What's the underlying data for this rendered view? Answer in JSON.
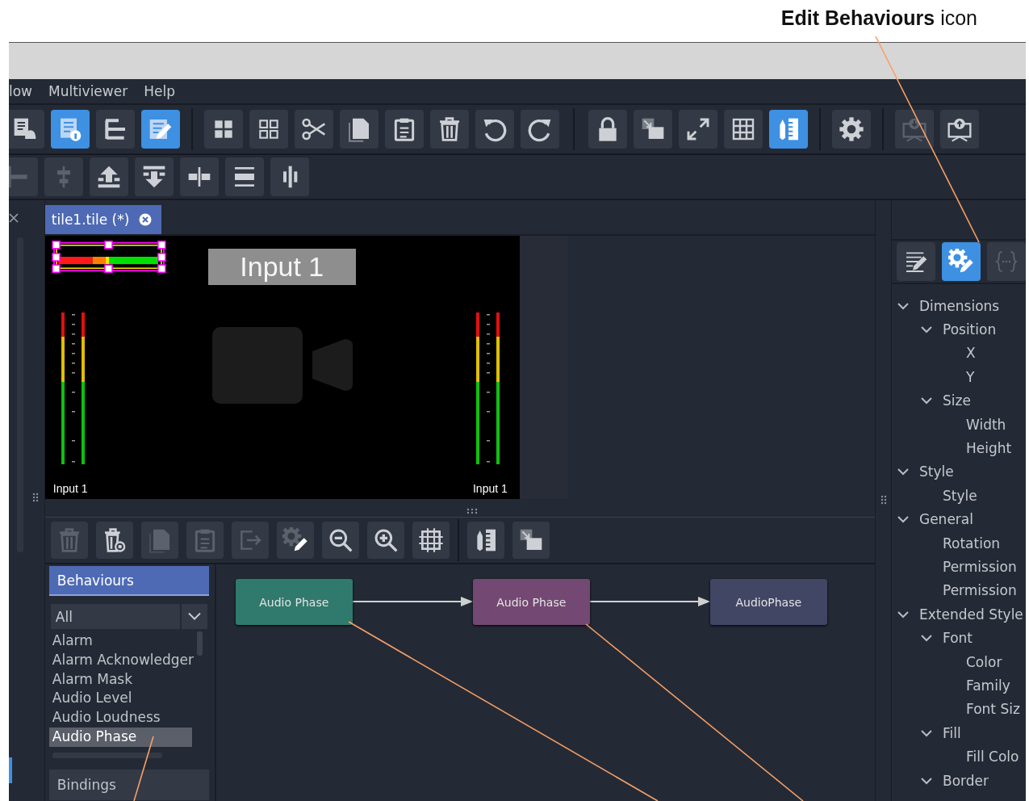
{
  "annotation": {
    "label": "**Edit Behaviours** icon"
  },
  "menu": [
    {
      "label": "low"
    },
    {
      "label": "Multiviewer"
    },
    {
      "label": "Help"
    }
  ],
  "toolbar": {
    "groups": [
      {
        "buttons": [
          {
            "kind": "alarm_doc",
            "selected": false,
            "disabled": false
          },
          {
            "kind": "doc_info",
            "selected": true,
            "disabled": false
          },
          {
            "kind": "hierarchy",
            "selected": false,
            "disabled": false
          },
          {
            "kind": "edit_doc",
            "selected": true,
            "disabled": false
          }
        ]
      },
      {
        "buttons": [
          {
            "kind": "grid_solid",
            "selected": false,
            "disabled": false
          },
          {
            "kind": "grid_outline",
            "selected": false,
            "disabled": false
          },
          {
            "kind": "scissors",
            "selected": false,
            "disabled": false
          },
          {
            "kind": "copy",
            "selected": false,
            "disabled": false
          },
          {
            "kind": "clipboard",
            "selected": false,
            "disabled": false
          },
          {
            "kind": "trash",
            "selected": false,
            "disabled": false
          },
          {
            "kind": "undo",
            "selected": false,
            "disabled": false
          },
          {
            "kind": "redo",
            "selected": false,
            "disabled": false
          }
        ]
      },
      {
        "buttons": [
          {
            "kind": "lock",
            "selected": false,
            "disabled": false
          },
          {
            "kind": "send_back",
            "selected": false,
            "disabled": false
          },
          {
            "kind": "expand",
            "selected": false,
            "disabled": false
          },
          {
            "kind": "table",
            "selected": false,
            "disabled": false
          },
          {
            "kind": "ruler_pencil",
            "selected": true,
            "disabled": false
          }
        ]
      },
      {
        "buttons": [
          {
            "kind": "gear",
            "selected": false,
            "disabled": false
          }
        ]
      },
      {
        "buttons": [
          {
            "kind": "monitor_down",
            "selected": false,
            "disabled": true
          },
          {
            "kind": "monitor_up",
            "selected": false,
            "disabled": false
          }
        ]
      }
    ]
  },
  "align_toolbar": {
    "buttons": [
      {
        "kind": "align_left",
        "selected": false,
        "disabled": true
      },
      {
        "kind": "align_center",
        "selected": false,
        "disabled": true
      },
      {
        "kind": "move_top",
        "selected": false,
        "disabled": false
      },
      {
        "kind": "move_bottom",
        "selected": false,
        "disabled": false
      },
      {
        "kind": "distribute_h",
        "selected": false,
        "disabled": false
      },
      {
        "kind": "distribute_v",
        "selected": false,
        "disabled": false
      },
      {
        "kind": "center_v",
        "selected": false,
        "disabled": false
      }
    ]
  },
  "editor_tab": {
    "label": "tile1.tile (*)",
    "selected": true
  },
  "canvas": {
    "title_label": "Input 1",
    "meter_labels": [
      "Input 1",
      "Input 1"
    ]
  },
  "graph_toolbar": {
    "groups": [
      {
        "buttons": [
          {
            "kind": "trash",
            "selected": false,
            "disabled": true
          },
          {
            "kind": "trash_clear",
            "selected": false,
            "disabled": false
          },
          {
            "kind": "copy",
            "selected": false,
            "disabled": true
          },
          {
            "kind": "clipboard",
            "selected": false,
            "disabled": true
          },
          {
            "kind": "export",
            "selected": false,
            "disabled": true
          },
          {
            "kind": "gear_edit",
            "selected": false,
            "disabled": true
          },
          {
            "kind": "zoom_out",
            "selected": false,
            "disabled": false
          },
          {
            "kind": "zoom_in",
            "selected": false,
            "disabled": false
          },
          {
            "kind": "fit_grid",
            "selected": false,
            "disabled": false
          }
        ]
      },
      {
        "buttons": [
          {
            "kind": "ruler_pencil",
            "selected": false,
            "disabled": false
          },
          {
            "kind": "send_back",
            "selected": false,
            "disabled": false
          }
        ]
      }
    ]
  },
  "behaviours_panel": {
    "title": "Behaviours",
    "filter": "All",
    "items": [
      {
        "label": "Alarm",
        "selected": false
      },
      {
        "label": "Alarm Acknowledger",
        "selected": false
      },
      {
        "label": "Alarm Mask",
        "selected": false
      },
      {
        "label": "Audio Level",
        "selected": false
      },
      {
        "label": "Audio Loudness",
        "selected": false
      },
      {
        "label": "Audio Phase",
        "selected": true
      }
    ],
    "footer": "Bindings"
  },
  "graph": {
    "nodes": [
      {
        "label": "Audio Phase",
        "color": "#2f7a6d"
      },
      {
        "label": "Audio Phase",
        "color": "#734872"
      },
      {
        "label": "AudioPhase",
        "color": "#424665"
      }
    ]
  },
  "properties_panel": {
    "tabs": [
      {
        "kind": "edit_text",
        "selected": false,
        "disabled": false
      },
      {
        "kind": "gear_edit",
        "selected": true,
        "disabled": false
      },
      {
        "kind": "braces",
        "selected": false,
        "disabled": true
      }
    ],
    "tree": [
      {
        "label": "Dimensions",
        "expanded": true,
        "children": [
          {
            "label": "Position",
            "expanded": true,
            "children": [
              {
                "label": "X"
              },
              {
                "label": "Y"
              }
            ]
          },
          {
            "label": "Size",
            "expanded": true,
            "children": [
              {
                "label": "Width"
              },
              {
                "label": "Height"
              }
            ]
          }
        ]
      },
      {
        "label": "Style",
        "expanded": true,
        "children": [
          {
            "label": "Style"
          }
        ]
      },
      {
        "label": "General",
        "expanded": true,
        "children": [
          {
            "label": "Rotation"
          },
          {
            "label": "Permission"
          },
          {
            "label": "Permission"
          }
        ]
      },
      {
        "label": "Extended Style",
        "expanded": true,
        "children": [
          {
            "label": "Font",
            "expanded": true,
            "children": [
              {
                "label": "Color"
              },
              {
                "label": "Family"
              },
              {
                "label": "Font Siz"
              }
            ]
          },
          {
            "label": "Fill",
            "expanded": true,
            "children": [
              {
                "label": "Fill Colo"
              }
            ]
          },
          {
            "label": "Border",
            "expanded": true
          }
        ]
      }
    ]
  }
}
